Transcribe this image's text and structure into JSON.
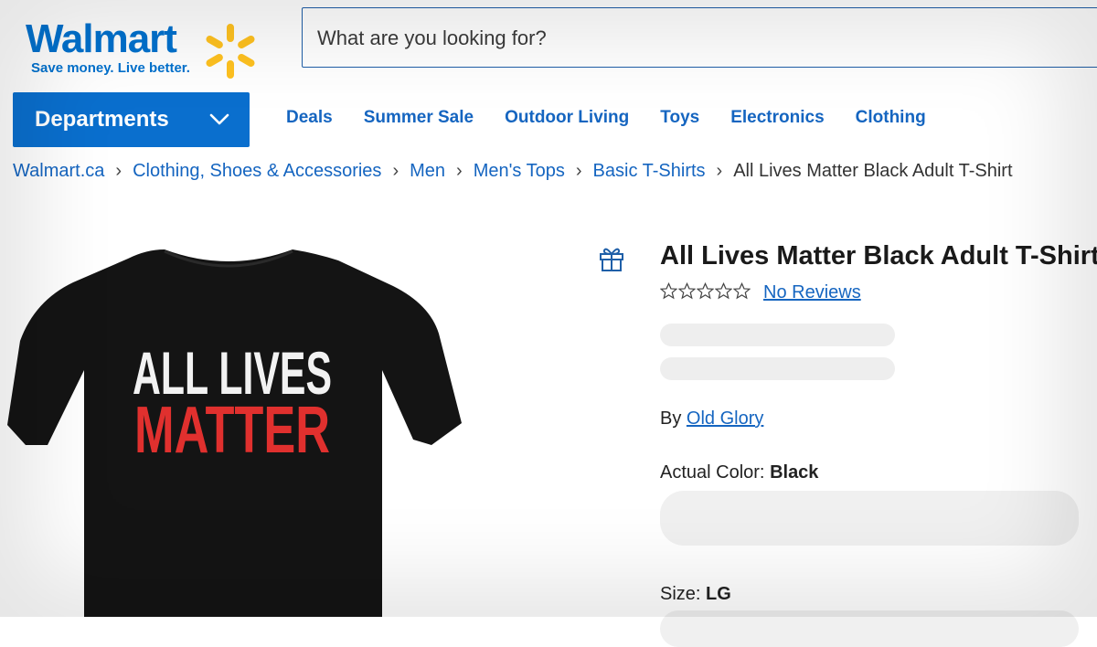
{
  "header": {
    "logo_word": "Walmart",
    "logo_tagline": "Save money. Live better.",
    "search_placeholder": "What are you looking for?"
  },
  "nav": {
    "departments_label": "Departments",
    "links": [
      "Deals",
      "Summer Sale",
      "Outdoor Living",
      "Toys",
      "Electronics",
      "Clothing"
    ]
  },
  "breadcrumb": {
    "items": [
      "Walmart.ca",
      "Clothing, Shoes & Accessories",
      "Men",
      "Men's Tops",
      "Basic T-Shirts"
    ],
    "current": "All Lives Matter Black Adult T-Shirt"
  },
  "product": {
    "title": "All Lives Matter Black Adult T-Shirt",
    "rating_stars": 0,
    "reviews_label": "No Reviews",
    "by_label": "By",
    "brand": "Old Glory",
    "color_label": "Actual Color:",
    "color_value": "Black",
    "size_label": "Size:",
    "size_value": "LG",
    "image": {
      "shirt_color": "#141414",
      "print_line1": "ALL LIVES",
      "print_line2": "MATTER",
      "line1_color": "#f2f2f2",
      "line2_color": "#e0302e"
    }
  },
  "colors": {
    "brand_blue": "#0071ce",
    "brand_yellow": "#ffc220",
    "link_blue": "#1565c0",
    "skeleton": "#eeeeee"
  },
  "icons": [
    "walmart-spark-icon",
    "chevron-down-icon",
    "chevron-right-icon",
    "gift-icon",
    "star-outline-icon"
  ]
}
